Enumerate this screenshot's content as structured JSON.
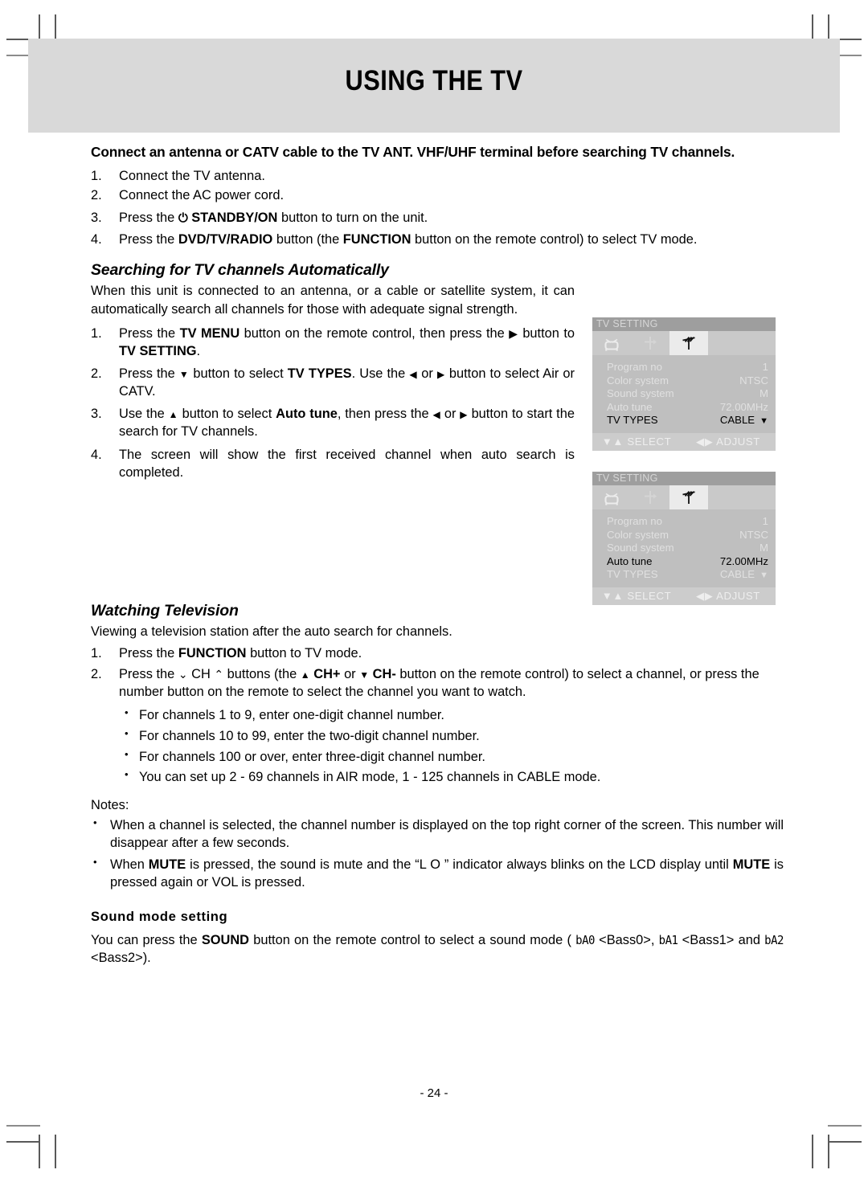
{
  "page": {
    "title": "USING THE TV",
    "number": "- 24 -"
  },
  "intro": {
    "lead_1": "Connect an antenna or CATV cable to the TV ANT. VHF/UHF terminal before searching TV",
    "lead_2": "channels.",
    "steps": [
      {
        "num": "1.",
        "text": "Connect the TV antenna."
      },
      {
        "num": "2.",
        "text": "Connect the AC power cord."
      },
      {
        "num": "3.",
        "pre": "Press the",
        "glyph": "⏻",
        "bold": "STANDBY/ON",
        "post": "button to turn on the unit."
      },
      {
        "num": "4.",
        "pre": "Press the",
        "bold": "DVD/TV/RADIO",
        "mid": "button (the",
        "bold2": "FUNCTION",
        "post": "button on the remote control) to select TV mode."
      }
    ]
  },
  "searching": {
    "heading": "Searching for TV channels Automatically",
    "intro": "When this unit is connected to an antenna, or a cable or satellite system, it can automatically search all channels for those with adequate signal strength.",
    "steps": [
      {
        "num": "1.",
        "p1": "Press the",
        "b1": "TV MENU",
        "p2": "button on the remote control, then press the",
        "arrow": "▶",
        "p3": "button to",
        "b2": "TV SETTING",
        "p4": "."
      },
      {
        "num": "2.",
        "p1": "Press the",
        "arrow1": "▼",
        "p2": "button to select",
        "b1": "TV TYPES",
        "p3": ". Use the",
        "arrow2": "◀",
        "p4": "or",
        "arrow3": "▶",
        "p5": "button to select Air or CATV."
      },
      {
        "num": "3.",
        "p1": "Use the",
        "arrow1": "▲",
        "p2": "button to select",
        "b1": "Auto tune",
        "p3": ", then press the",
        "arrow2": "◀",
        "p4": "or",
        "arrow3": "▶",
        "p5": "button to start the search for TV channels."
      },
      {
        "num": "4.",
        "p1": "The screen will show the first received channel when auto search is completed."
      }
    ]
  },
  "osd": {
    "title": "TV SETTING",
    "icons": [
      {
        "name": "tv-icon",
        "selected": false
      },
      {
        "name": "tuning-cross-icon",
        "selected": false
      },
      {
        "name": "antenna-icon",
        "selected": true
      }
    ],
    "rows": [
      {
        "label": "Program no",
        "value": "1"
      },
      {
        "label": "Color system",
        "value": "NTSC"
      },
      {
        "label": "Sound system",
        "value": "M"
      },
      {
        "label": "Auto tune",
        "value": "72.00MHz"
      },
      {
        "label": "TV TYPES",
        "value": "CABLE",
        "caret": "▼"
      }
    ],
    "footer": {
      "select_arrows": "▼▲",
      "select_label": "SELECT",
      "adjust_arrows": "◀▶",
      "adjust_label": "ADJUST"
    },
    "panel_1_highlight": "TV TYPES",
    "panel_2_highlight": "Auto tune"
  },
  "watching": {
    "heading": "Watching Television",
    "intro": "Viewing a television station after the auto search for channels.",
    "steps": [
      {
        "num": "1.",
        "p1": "Press the",
        "b1": "FUNCTION",
        "p2": "button to TV mode."
      },
      {
        "num": "2.",
        "p1": "Press the",
        "a1": "⌄",
        "p2": "CH",
        "a2": "⌃",
        "p3": "buttons (the",
        "a3": "▲",
        "b1": "CH+",
        "p4": "or",
        "a4": "▼",
        "b2": "CH-",
        "p5": "button on the remote control) to select a channel, or press the number button on the remote to select the channel you want to watch."
      }
    ],
    "bullets": [
      "For channels 1 to 9, enter one-digit channel number.",
      "For channels 10 to 99, enter the two-digit channel number.",
      "For channels 100 or over, enter three-digit channel number.",
      "You can set up 2 - 69 channels in AIR mode, 1 - 125 channels in CABLE mode."
    ]
  },
  "notes": {
    "heading": "Notes:",
    "items": [
      {
        "p1": "When a channel is selected, the channel number is displayed on the top right corner of the screen. This number will disappear after a few seconds."
      },
      {
        "p1": "When",
        "b1": "MUTE",
        "p2": "is pressed, the sound is mute and the “L O ” indicator always blinks on the LCD display until",
        "b2": "MUTE",
        "p3": "is pressed again or VOL is pressed."
      }
    ]
  },
  "sound_mode": {
    "heading": "Sound mode setting",
    "p1": "You can press the",
    "b1": "SOUND",
    "p2": "button on the remote control to select a sound mode (",
    "lcd1": "bA0",
    "t1": "<Bass0>,",
    "lcd2": "bA1",
    "t2": "<Bass1> and",
    "lcd3": "bA2",
    "t3": "<Bass2>)."
  }
}
